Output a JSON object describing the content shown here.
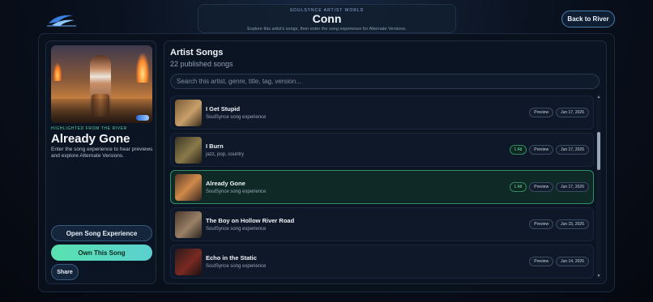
{
  "header": {
    "kicker": "SOULSYNCE ARTIST WORLD",
    "title": "Conn",
    "subtitle": "Explore this artist's songs, then enter the song experience for Alternate Versions."
  },
  "nav": {
    "back_label": "Back to River"
  },
  "highlight": {
    "kicker": "HIGHLIGHTED FROM THE RIVER",
    "title": "Already Gone",
    "description": "Enter the song experience to hear previews and explore Alternate Versions.",
    "open_label": "Open Song Experience",
    "own_label": "Own This Song",
    "share_label": "Share"
  },
  "songs": {
    "title": "Artist Songs",
    "count": "22 published songs",
    "search_placeholder": "Search this artist, genre, title, tag, version...",
    "items": [
      {
        "title": "I Get Stupid",
        "subtitle": "SoulSynce song experience",
        "alt": "",
        "preview": "Preview",
        "date": "Jun 17, 2026"
      },
      {
        "title": "I Burn",
        "subtitle": "jazz, pop, country",
        "alt": "1 Alt",
        "preview": "Preview",
        "date": "Jun 17, 2026"
      },
      {
        "title": "Already Gone",
        "subtitle": "SoulSynce song experience",
        "alt": "1 Alt",
        "preview": "Preview",
        "date": "Jun 17, 2026"
      },
      {
        "title": "The Boy on Hollow River Road",
        "subtitle": "SoulSynce song experience",
        "alt": "",
        "preview": "Preview",
        "date": "Jun 15, 2026"
      },
      {
        "title": "Echo in the Static",
        "subtitle": "SoulSynce song experience",
        "alt": "",
        "preview": "Preview",
        "date": "Jun 14, 2026"
      }
    ]
  },
  "colors": {
    "accent_green": "#59e2b0",
    "selected_border": "#2f8f6a",
    "background": "#0a1220"
  },
  "icons": {
    "logo": "soulsynce-logo",
    "scroll_up": "▲",
    "scroll_down": "▼"
  }
}
